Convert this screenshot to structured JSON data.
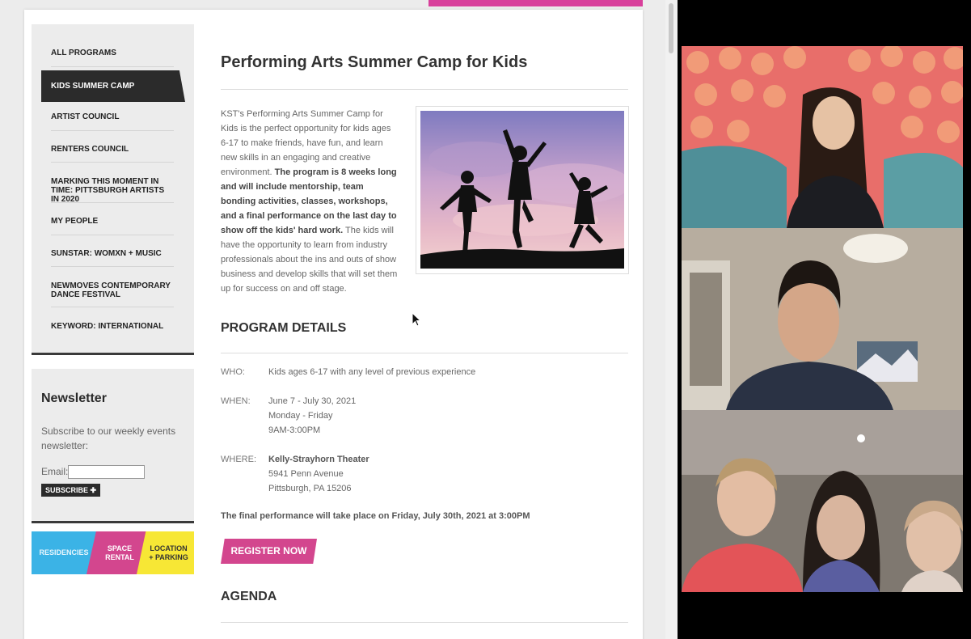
{
  "sidebar": {
    "items": [
      {
        "label": "ALL PROGRAMS"
      },
      {
        "label": "KIDS SUMMER CAMP",
        "active": true
      },
      {
        "label": "ARTIST COUNCIL"
      },
      {
        "label": "RENTERS COUNCIL"
      },
      {
        "label": "MARKING THIS MOMENT IN TIME: PITTSBURGH ARTISTS IN 2020"
      },
      {
        "label": "MY PEOPLE"
      },
      {
        "label": "SUNSTAR: WOMXN + MUSIC"
      },
      {
        "label": "NEWMOVES CONTEMPORARY DANCE FESTIVAL"
      },
      {
        "label": "KEYWORD: INTERNATIONAL"
      }
    ]
  },
  "newsletter": {
    "title": "Newsletter",
    "text": "Subscribe to our weekly events newsletter:",
    "email_label": "Email:",
    "email_value": "",
    "subscribe_label": "SUBSCRIBE ✚"
  },
  "tiles": [
    {
      "label": "RESIDENCIES",
      "color": "#3bb3e6",
      "text_color": "#e8f6fd"
    },
    {
      "label": "SPACE RENTAL",
      "color": "#d3468e",
      "text_color": "#ffffff"
    },
    {
      "label": "LOCATION + PARKING",
      "color": "#f7e735",
      "text_color": "#333333"
    }
  ],
  "main": {
    "title": "Performing Arts Summer Camp for Kids",
    "intro_a": "KST's Performing Arts Summer Camp for Kids is the perfect opportunity for kids ages 6-17 to make friends, have fun, and learn new skills in an engaging and creative environment. ",
    "intro_b": "The program is 8 weeks long and will include mentorship, team bonding activities, classes, workshops, and a final performance on the last day to show off the kids' hard work.",
    "intro_c": " The kids will have the opportunity to learn from industry professionals about the ins and outs of show business and develop skills that will set them up for success on and off stage.",
    "details_heading": "PROGRAM DETAILS",
    "who_label": "WHO:",
    "who_value": "Kids ages 6-17 with any level of previous experience",
    "when_label": "WHEN:",
    "when_lines": [
      "June 7 - July 30, 2021",
      "Monday - Friday",
      "9AM-3:00PM"
    ],
    "where_label": "WHERE:",
    "where_lines": [
      "Kelly-Strayhorn Theater",
      "5941 Penn Avenue",
      "Pittsburgh, PA 15206"
    ],
    "final_note": "The final performance will take place on Friday, July 30th, 2021 at 3:00PM",
    "register_label": "REGISTER NOW",
    "agenda_heading": "AGENDA"
  },
  "video_call": {
    "participants": [
      {
        "tile": "participant-1"
      },
      {
        "tile": "participant-2"
      },
      {
        "tile": "participant-3"
      }
    ]
  },
  "colors": {
    "accent_pink": "#d3468e",
    "nav_active": "#2b2b2b",
    "sidebar_bg": "#ececec"
  }
}
